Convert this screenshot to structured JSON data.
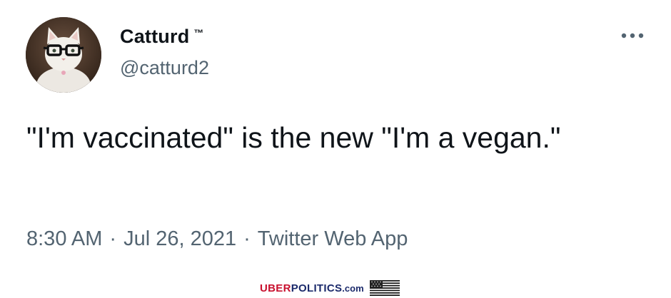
{
  "author": {
    "display_name": "Catturd",
    "badge": "™",
    "handle": "@catturd2",
    "avatar_icon": "cat-with-glasses-avatar"
  },
  "menu": {
    "icon": "more-horizontal-icon"
  },
  "tweet": {
    "text": "\"I'm vaccinated\" is the new \"I'm a vegan.\"",
    "time": "8:30 AM",
    "date": "Jul 26, 2021",
    "source": "Twitter Web App",
    "separator": "·"
  },
  "watermark": {
    "uber": "UBER",
    "politics": "POLITICS",
    "domain": ".com",
    "flag_icon": "us-flag-icon"
  },
  "colors": {
    "text_primary": "#0f1419",
    "text_secondary": "#536471",
    "watermark_red": "#c8102e",
    "watermark_blue": "#1b2a6b"
  }
}
